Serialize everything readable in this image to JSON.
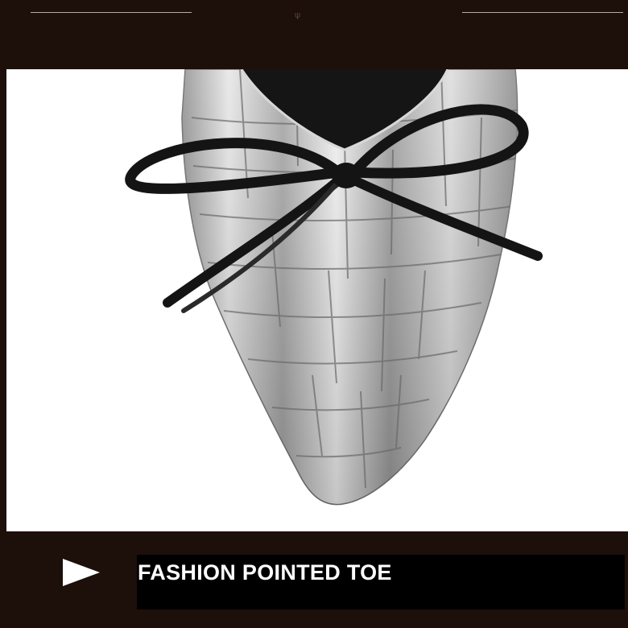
{
  "banner": {
    "caption": "FASHION POINTED TOE",
    "play_icon": "play-arrow-icon",
    "caption_icon_color": "#ffffff"
  },
  "colors": {
    "frame": "#1d0f0a",
    "caption_bar": "#000000",
    "photo_background": "#ffffff",
    "leather": "#c9c9c9",
    "bow": "#141414"
  }
}
